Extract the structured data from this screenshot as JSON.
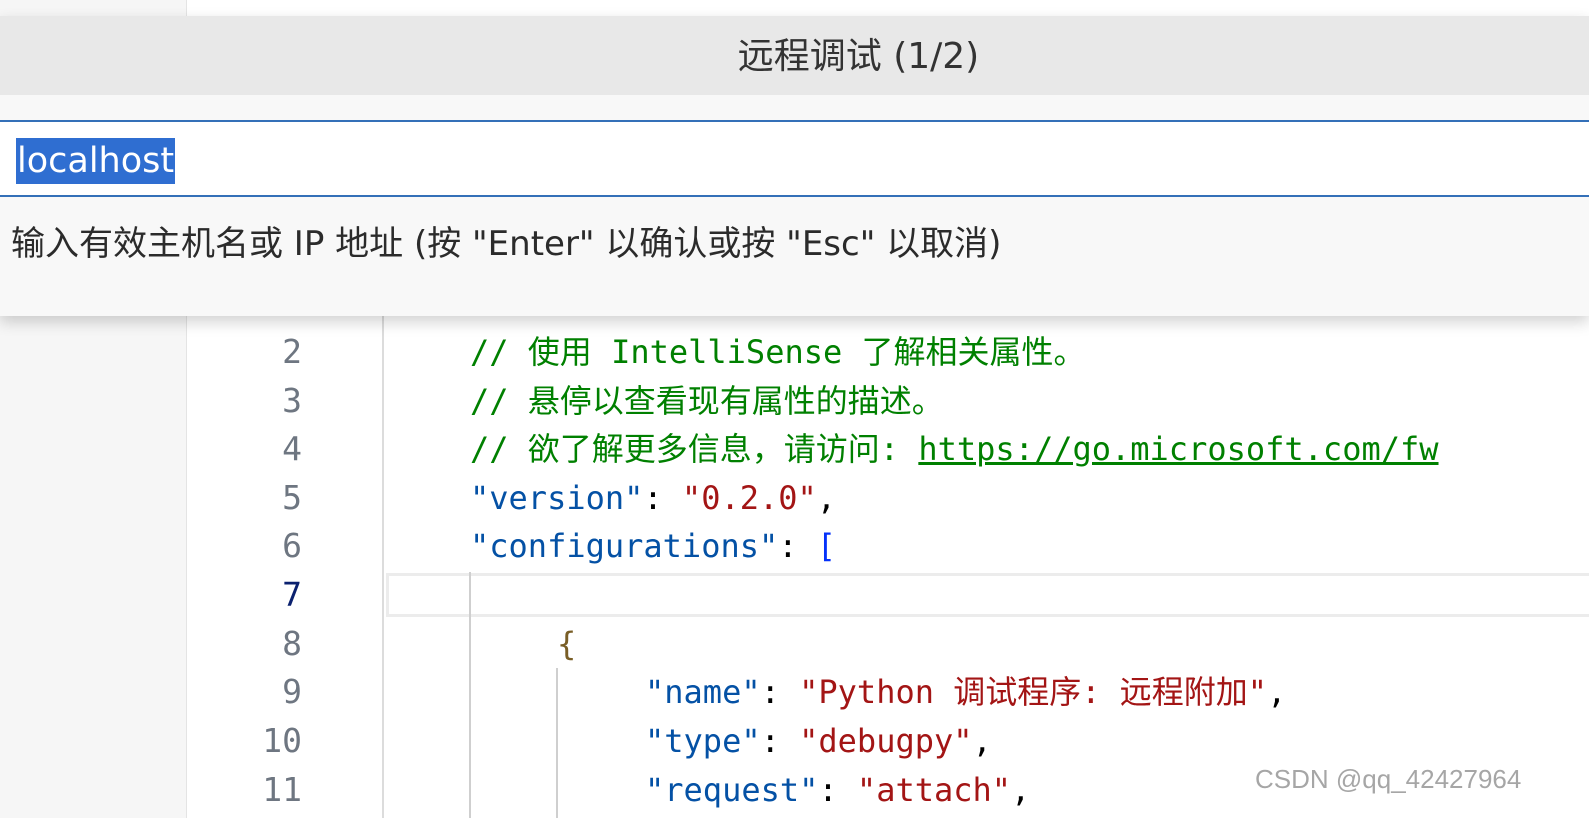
{
  "quick_input": {
    "title": "远程调试 (1/2)",
    "input_value": "localhost",
    "message": "输入有效主机名或 IP 地址 (按 \"Enter\" 以确认或按 \"Esc\" 以取消)"
  },
  "editor": {
    "lines": [
      {
        "num": "2",
        "comment": "// 使用 IntelliSense 了解相关属性。"
      },
      {
        "num": "3",
        "comment": "// 悬停以查看现有属性的描述。"
      },
      {
        "num": "4",
        "comment": "// 欲了解更多信息，请访问: ",
        "url": "https://go.microsoft.com/fw"
      },
      {
        "num": "5",
        "key": "\"version\"",
        "sep": ": ",
        "value": "\"0.2.0\"",
        "tail": ","
      },
      {
        "num": "6",
        "key": "\"configurations\"",
        "sep": ": ",
        "bracket": "["
      },
      {
        "num": "7"
      },
      {
        "num": "8",
        "brace": "{"
      },
      {
        "num": "9",
        "key": "\"name\"",
        "sep": ": ",
        "value": "\"Python 调试程序: 远程附加\"",
        "tail": ","
      },
      {
        "num": "10",
        "key": "\"type\"",
        "sep": ": ",
        "value": "\"debugpy\"",
        "tail": ","
      },
      {
        "num": "11",
        "key": "\"request\"",
        "sep": ": ",
        "value": "\"attach\"",
        "tail": ","
      }
    ],
    "active_line": "7"
  },
  "watermark": "CSDN @qq_42427964",
  "colors": {
    "accent": "#3470b8",
    "selection": "#2f6ed1",
    "comment": "#008000",
    "json_key": "#0451a5",
    "json_string": "#a31515"
  }
}
